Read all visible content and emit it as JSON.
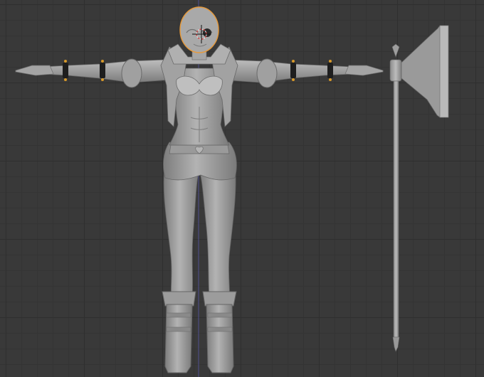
{
  "viewport": {
    "background": "#393939",
    "grid_color": "#303030",
    "axis_color": "#4a4a8a"
  },
  "scene": {
    "mesh_color": "#a9a9a9",
    "shadow_color": "#6f6f6f",
    "accent_color": "#d89a2a",
    "selection_color": "#e69a3c",
    "cursor_icon": "3d-cursor-icon",
    "objects": [
      "character-mesh",
      "halberd-mesh"
    ]
  }
}
